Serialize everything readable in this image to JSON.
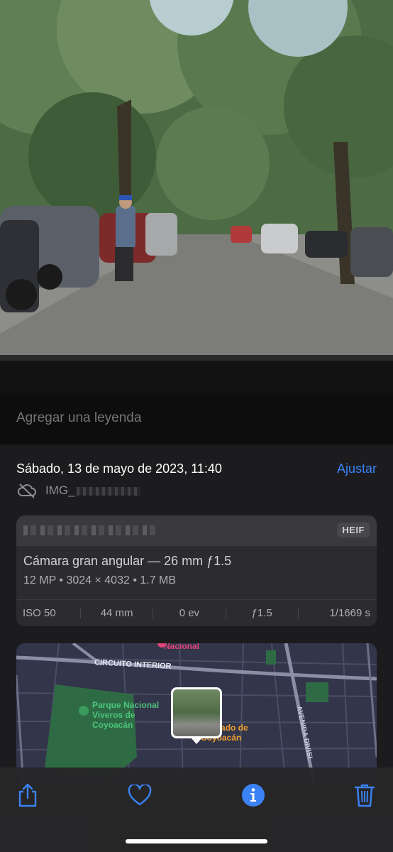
{
  "caption": {
    "placeholder": "Agregar una leyenda"
  },
  "info": {
    "date": "Sábado, 13 de mayo de 2023, 11:40",
    "adjust_label": "Ajustar",
    "filename": "IMG_"
  },
  "camera": {
    "format_badge": "HEIF",
    "lens": "Cámara gran angular — 26 mm ƒ1.5",
    "specs": "12 MP  •  3024 × 4032  •  1.7 MB",
    "exif": {
      "iso": "ISO 50",
      "focal": "44 mm",
      "ev": "0 ev",
      "aperture": "ƒ1.5",
      "shutter": "1/1669 s"
    }
  },
  "map": {
    "label_nacional": "Nacional",
    "label_circuito": "CIRCUITO INTERIOR",
    "label_parque": "Parque Nacional\nViveros de\nCoyoacán",
    "label_mercado": "Mercado de\nCoyoacán",
    "label_avenida": "AVENIDA DIVISI",
    "park_color": "#2e6b45",
    "road_color": "#8a8fa6"
  },
  "toolbar": {
    "share": "share-icon",
    "favorite": "heart-icon",
    "info": "info-icon",
    "delete": "trash-icon"
  },
  "colors": {
    "accent": "#3b82f6",
    "panel": "#1c1c1e",
    "card": "#2c2c2e"
  }
}
